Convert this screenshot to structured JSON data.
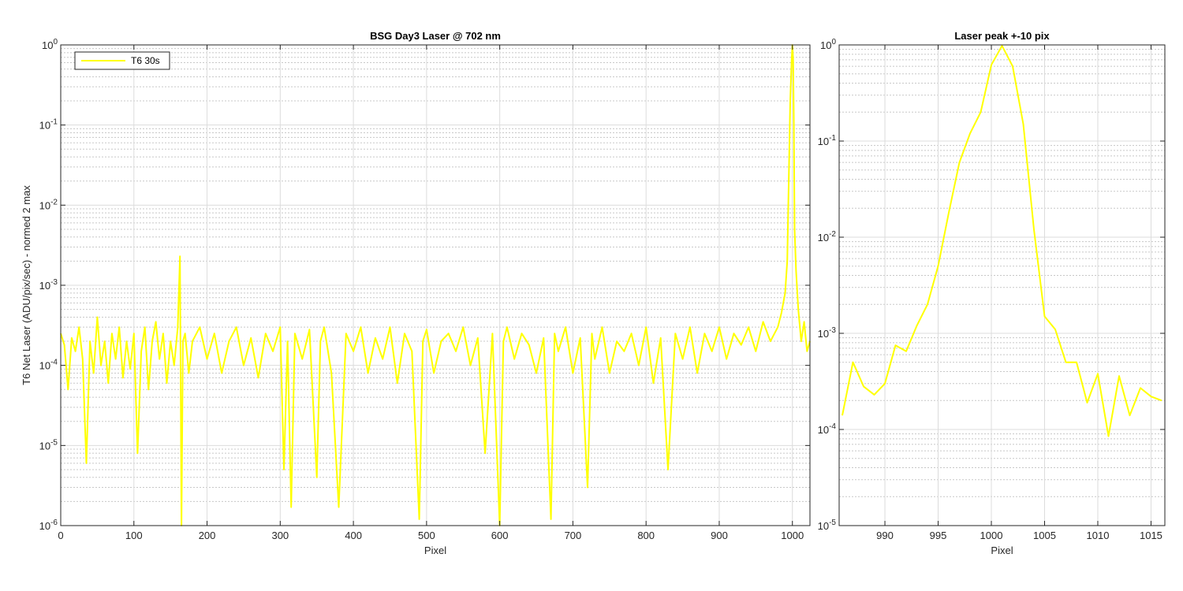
{
  "chart_data": [
    {
      "type": "line",
      "title": "BSG  Day3 Laser @ 702 nm",
      "xlabel": "Pixel",
      "ylabel": "T6 Net Laser (ADU/pix/sec) - normed 2 max",
      "xlim": [
        0,
        1024
      ],
      "ylim": [
        1e-06,
        1
      ],
      "yscale": "log",
      "grid": true,
      "minor_grid": true,
      "xticks": [
        0,
        100,
        200,
        300,
        400,
        500,
        600,
        700,
        800,
        900,
        1000
      ],
      "yticks": [
        {
          "value": 1e-06,
          "base": "10",
          "exp": "-6"
        },
        {
          "value": 1e-05,
          "base": "10",
          "exp": "-5"
        },
        {
          "value": 0.0001,
          "base": "10",
          "exp": "-4"
        },
        {
          "value": 0.001,
          "base": "10",
          "exp": "-3"
        },
        {
          "value": 0.01,
          "base": "10",
          "exp": "-2"
        },
        {
          "value": 0.1,
          "base": "10",
          "exp": "-1"
        },
        {
          "value": 1,
          "base": "10",
          "exp": "0"
        }
      ],
      "legend": {
        "location": "top-left",
        "entries": [
          "T6 30s"
        ]
      },
      "series": [
        {
          "name": "T6 30s",
          "color": "#ffff00",
          "x": [
            0,
            5,
            10,
            15,
            20,
            25,
            30,
            35,
            40,
            45,
            50,
            55,
            60,
            65,
            70,
            75,
            80,
            85,
            90,
            95,
            100,
            105,
            110,
            115,
            120,
            125,
            130,
            135,
            140,
            145,
            150,
            155,
            160,
            163,
            165,
            167,
            170,
            175,
            180,
            190,
            200,
            210,
            220,
            230,
            240,
            250,
            260,
            270,
            280,
            290,
            300,
            305,
            310,
            315,
            320,
            330,
            340,
            350,
            355,
            360,
            370,
            380,
            390,
            400,
            410,
            420,
            430,
            440,
            450,
            460,
            470,
            480,
            490,
            495,
            500,
            510,
            520,
            530,
            540,
            550,
            560,
            570,
            580,
            590,
            600,
            605,
            610,
            620,
            630,
            640,
            650,
            660,
            670,
            675,
            680,
            690,
            700,
            710,
            720,
            726,
            730,
            740,
            750,
            760,
            770,
            780,
            790,
            800,
            810,
            820,
            830,
            840,
            850,
            860,
            870,
            880,
            890,
            900,
            910,
            920,
            930,
            940,
            950,
            960,
            970,
            980,
            985,
            990,
            993,
            995,
            997,
            999,
            1000,
            1001,
            1002,
            1003,
            1005,
            1008,
            1012,
            1016,
            1020,
            1024
          ],
          "y": [
            0.00025,
            0.00018,
            5e-05,
            0.00022,
            0.00015,
            0.0003,
            0.00012,
            6e-06,
            0.0002,
            8e-05,
            0.0004,
            0.0001,
            0.0002,
            6e-05,
            0.00025,
            0.00012,
            0.0003,
            7e-05,
            0.0002,
            9e-05,
            0.00025,
            8e-06,
            0.00015,
            0.0003,
            5e-05,
            0.0002,
            0.00035,
            0.00012,
            0.00025,
            6e-05,
            0.0002,
            0.0001,
            0.0003,
            0.0023,
            1e-06,
            0.0002,
            0.00025,
            8e-05,
            0.0002,
            0.0003,
            0.00012,
            0.00025,
            8e-05,
            0.0002,
            0.0003,
            0.0001,
            0.00022,
            7e-05,
            0.00025,
            0.00015,
            0.0003,
            5e-06,
            0.0002,
            1.7e-06,
            0.00025,
            0.00012,
            0.00028,
            4e-06,
            0.0002,
            0.0003,
            8e-05,
            1.7e-06,
            0.00025,
            0.00015,
            0.0003,
            8e-05,
            0.00022,
            0.00012,
            0.0003,
            6e-05,
            0.00025,
            0.00015,
            1.2e-06,
            0.0002,
            0.00028,
            8e-05,
            0.0002,
            0.00025,
            0.00015,
            0.0003,
            0.0001,
            0.00022,
            8e-06,
            0.00025,
            1e-06,
            0.0002,
            0.0003,
            0.00012,
            0.00025,
            0.00018,
            8e-05,
            0.00022,
            1.2e-06,
            0.00025,
            0.00015,
            0.0003,
            8e-05,
            0.00022,
            3e-06,
            0.00025,
            0.00012,
            0.0003,
            8e-05,
            0.0002,
            0.00015,
            0.00025,
            0.0001,
            0.0003,
            6e-05,
            0.00022,
            5e-06,
            0.00025,
            0.00012,
            0.0003,
            8e-05,
            0.00025,
            0.00015,
            0.0003,
            0.00012,
            0.00025,
            0.00018,
            0.0003,
            0.00015,
            0.00035,
            0.0002,
            0.0003,
            0.00045,
            0.0008,
            0.002,
            0.02,
            0.2,
            0.65,
            1.0,
            0.65,
            0.1,
            0.005,
            0.0015,
            0.0005,
            0.0002,
            0.00035,
            0.00015,
            0.0002
          ]
        }
      ]
    },
    {
      "type": "line",
      "title": "Laser peak +-10 pix",
      "xlabel": "Pixel",
      "ylabel": "",
      "xlim": [
        985.7,
        1016.3
      ],
      "ylim": [
        1e-05,
        1
      ],
      "yscale": "log",
      "grid": true,
      "minor_grid": true,
      "xticks": [
        990,
        995,
        1000,
        1005,
        1010,
        1015
      ],
      "yticks": [
        {
          "value": 1e-05,
          "base": "10",
          "exp": "-5"
        },
        {
          "value": 0.0001,
          "base": "10",
          "exp": "-4"
        },
        {
          "value": 0.001,
          "base": "10",
          "exp": "-3"
        },
        {
          "value": 0.01,
          "base": "10",
          "exp": "-2"
        },
        {
          "value": 0.1,
          "base": "10",
          "exp": "-1"
        },
        {
          "value": 1,
          "base": "10",
          "exp": "0"
        }
      ],
      "series": [
        {
          "color": "#ffff00",
          "x": [
            986,
            987,
            988,
            989,
            990,
            991,
            992,
            993,
            994,
            995,
            996,
            997,
            998,
            999,
            1000,
            1001,
            1002,
            1003,
            1004,
            1005,
            1006,
            1007,
            1008,
            1009,
            1010,
            1011,
            1012,
            1013,
            1014,
            1015,
            1016
          ],
          "y": [
            0.00014,
            0.0005,
            0.00028,
            0.00023,
            0.0003,
            0.00075,
            0.00065,
            0.0012,
            0.002,
            0.005,
            0.018,
            0.06,
            0.12,
            0.2,
            0.62,
            0.98,
            0.6,
            0.15,
            0.012,
            0.0015,
            0.0011,
            0.0005,
            0.0005,
            0.00019,
            0.00038,
            8.5e-05,
            0.00036,
            0.00014,
            0.00027,
            0.00022,
            0.0002
          ]
        }
      ]
    }
  ]
}
